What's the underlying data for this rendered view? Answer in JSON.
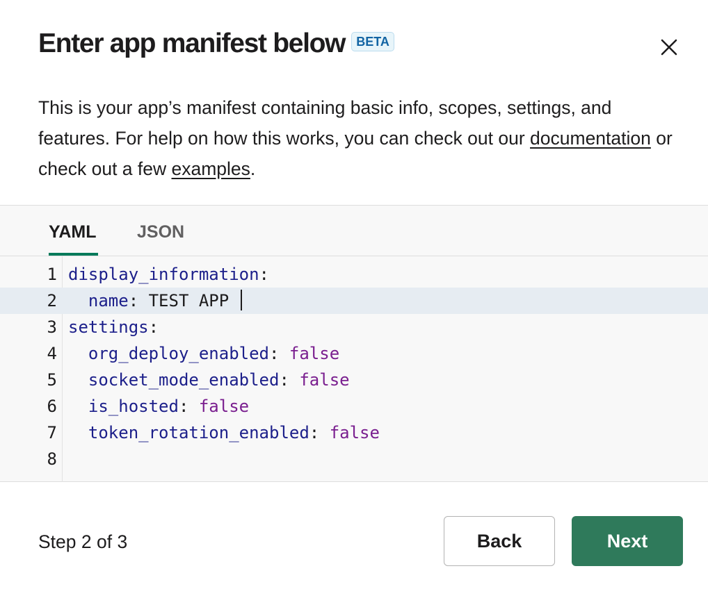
{
  "header": {
    "title": "Enter app manifest below",
    "badge": "BETA",
    "close_icon": "close-icon"
  },
  "description": {
    "text_before": "This is your app’s manifest containing basic info, scopes, settings, and features. For help on how this works, you can check out our ",
    "docs_link": "documentation",
    "text_middle": " or check out a few ",
    "examples_link": "examples",
    "text_after": "."
  },
  "tabs": [
    {
      "label": "YAML",
      "active": true
    },
    {
      "label": "JSON",
      "active": false
    }
  ],
  "editor": {
    "lines": [
      {
        "num": "1",
        "indent": "",
        "key": "display_information",
        "colon": ":",
        "value": "",
        "value_type": ""
      },
      {
        "num": "2",
        "indent": "  ",
        "key": "name",
        "colon": ":",
        "value": " TEST APP ",
        "value_type": "string",
        "active": true
      },
      {
        "num": "3",
        "indent": "",
        "key": "settings",
        "colon": ":",
        "value": "",
        "value_type": ""
      },
      {
        "num": "4",
        "indent": "  ",
        "key": "org_deploy_enabled",
        "colon": ":",
        "value": " false",
        "value_type": "bool"
      },
      {
        "num": "5",
        "indent": "  ",
        "key": "socket_mode_enabled",
        "colon": ":",
        "value": " false",
        "value_type": "bool"
      },
      {
        "num": "6",
        "indent": "  ",
        "key": "is_hosted",
        "colon": ":",
        "value": " false",
        "value_type": "bool"
      },
      {
        "num": "7",
        "indent": "  ",
        "key": "token_rotation_enabled",
        "colon": ":",
        "value": " false",
        "value_type": "bool"
      },
      {
        "num": "8",
        "indent": "",
        "key": "",
        "colon": "",
        "value": "",
        "value_type": ""
      }
    ]
  },
  "footer": {
    "step_text": "Step 2 of 3",
    "back_label": "Back",
    "next_label": "Next"
  },
  "colors": {
    "accent_green": "#007a5a",
    "next_button": "#2f7a5b",
    "yaml_key": "#1c1f8a",
    "yaml_bool": "#7a1f8f"
  }
}
